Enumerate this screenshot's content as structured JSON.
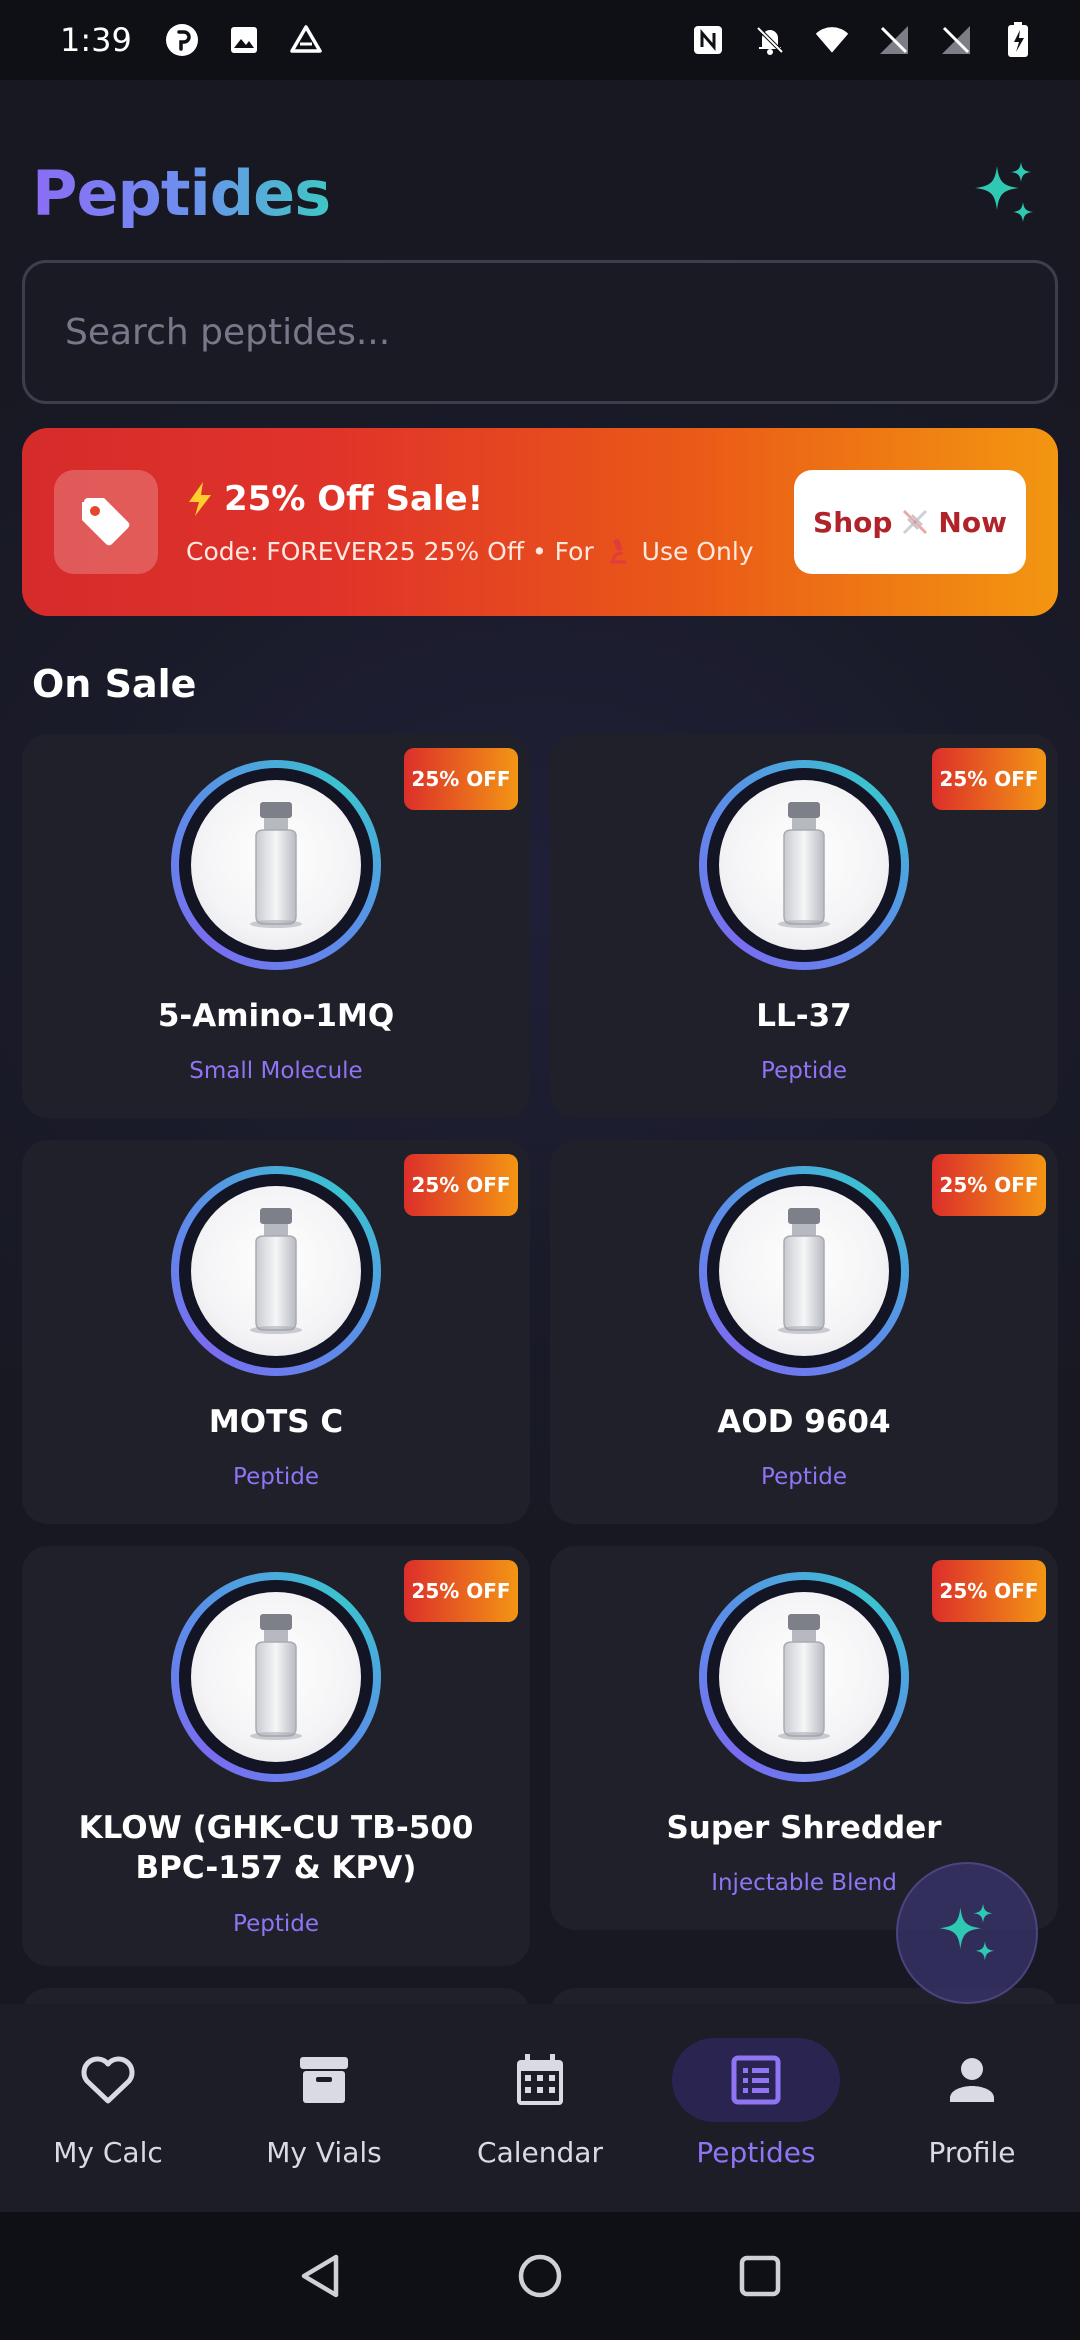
{
  "status_bar": {
    "time": "1:39",
    "icons_left": [
      "pinterest-icon",
      "gallery-icon",
      "drive-icon"
    ],
    "icons_right": [
      "nfc-icon",
      "notifications-off-icon",
      "wifi-icon",
      "signal-off-icon",
      "signal-off-icon",
      "battery-charging-icon"
    ]
  },
  "header": {
    "title": "Peptides",
    "sparkle_icon": "sparkle-icon"
  },
  "search": {
    "placeholder": "Search peptides..."
  },
  "promo": {
    "icon": "tag-icon",
    "title": "25% Off Sale!",
    "title_icon": "lightning-icon",
    "subtitle_before": "Code: FOREVER25 25% Off • For",
    "subtitle_after": "Use Only",
    "subtitle_icon": "microscope-icon",
    "button_before": "Shop",
    "button_after": "Now",
    "button_icon": "dna-icon",
    "colors": {
      "start": "#d62b2b",
      "end": "#f39611",
      "button_text": "#b0232a"
    }
  },
  "section": {
    "title": "On Sale"
  },
  "products": [
    {
      "name": "5-Amino-1MQ",
      "type": "Small Molecule",
      "badge": "25% OFF"
    },
    {
      "name": "LL-37",
      "type": "Peptide",
      "badge": "25% OFF"
    },
    {
      "name": "MOTS C",
      "type": "Peptide",
      "badge": "25% OFF"
    },
    {
      "name": "AOD 9604",
      "type": "Peptide",
      "badge": "25% OFF"
    },
    {
      "name": "KLOW (GHK-CU TB-500 BPC-157 & KPV)",
      "type": "Peptide",
      "badge": "25% OFF"
    },
    {
      "name": "Super Shredder",
      "type": "Injectable Blend",
      "badge": "25% OFF"
    }
  ],
  "fab": {
    "icon": "sparkle-icon"
  },
  "bottom_nav": [
    {
      "label": "My Calc",
      "icon": "heart-icon",
      "active": false
    },
    {
      "label": "My Vials",
      "icon": "archive-box-icon",
      "active": false
    },
    {
      "label": "Calendar",
      "icon": "calendar-icon",
      "active": false
    },
    {
      "label": "Peptides",
      "icon": "list-icon",
      "active": true
    },
    {
      "label": "Profile",
      "icon": "person-icon",
      "active": false
    }
  ],
  "system_nav": [
    "back-icon",
    "home-icon",
    "recents-icon"
  ],
  "theme": {
    "accent": "#8f74f4",
    "teal": "#3fc7c3",
    "background": "#171821",
    "card": "#1f2029"
  }
}
